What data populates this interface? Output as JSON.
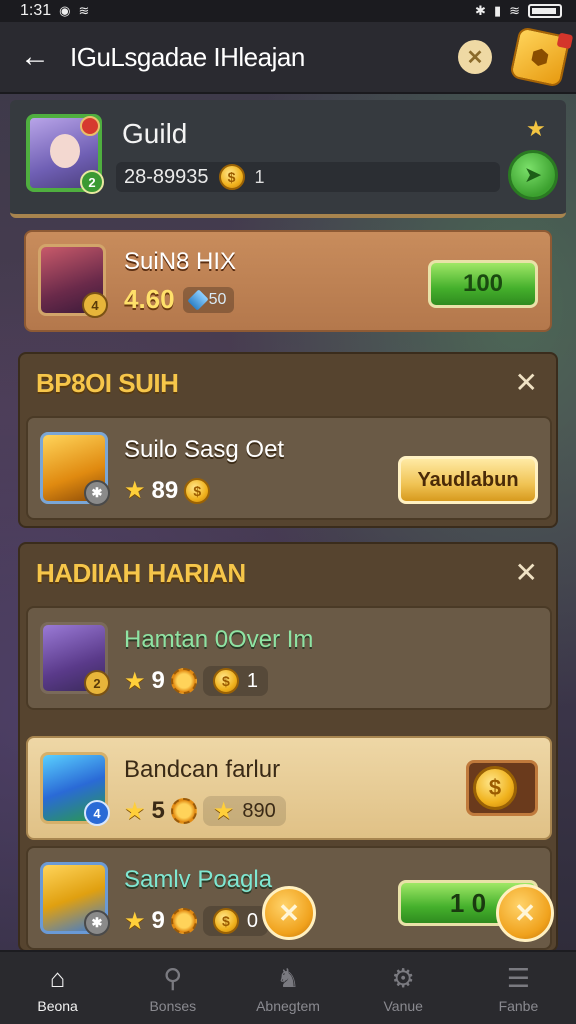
{
  "status_bar": {
    "time": "1:31"
  },
  "header": {
    "title": "IGuLsgadae IHleajan"
  },
  "guild": {
    "name": "Guild",
    "code": "28-89935",
    "bar_value": "1",
    "level": "2"
  },
  "member": {
    "name": "SuiN8 HIX",
    "score": "4.60",
    "gem_value": "50",
    "level": "4",
    "button_label": "100"
  },
  "section1": {
    "title": "BP8OI SUIH",
    "quest": {
      "name": "Suilo Sasg Oet",
      "value": "89",
      "button_label": "Yaudlabun"
    }
  },
  "section2": {
    "title": "HADIIAH HARIAN",
    "quests": [
      {
        "name": "Hamtan 0Over Im",
        "value": "9",
        "pill_value": "1",
        "level": "2"
      },
      {
        "name": "Bandcan farlur",
        "value": "5",
        "pill_value": "890",
        "level": "4"
      },
      {
        "name": "Samlv Poagla",
        "value": "9",
        "pill_value": "0",
        "button_label": "1 0"
      }
    ]
  },
  "nav": {
    "items": [
      {
        "label": "Beona",
        "icon": "home-icon"
      },
      {
        "label": "Bonses",
        "icon": "search-icon"
      },
      {
        "label": "Abnegtem",
        "icon": "dragon-icon"
      },
      {
        "label": "Vanue",
        "icon": "gear-icon"
      },
      {
        "label": "Fanbe",
        "icon": "menu-icon"
      }
    ]
  }
}
